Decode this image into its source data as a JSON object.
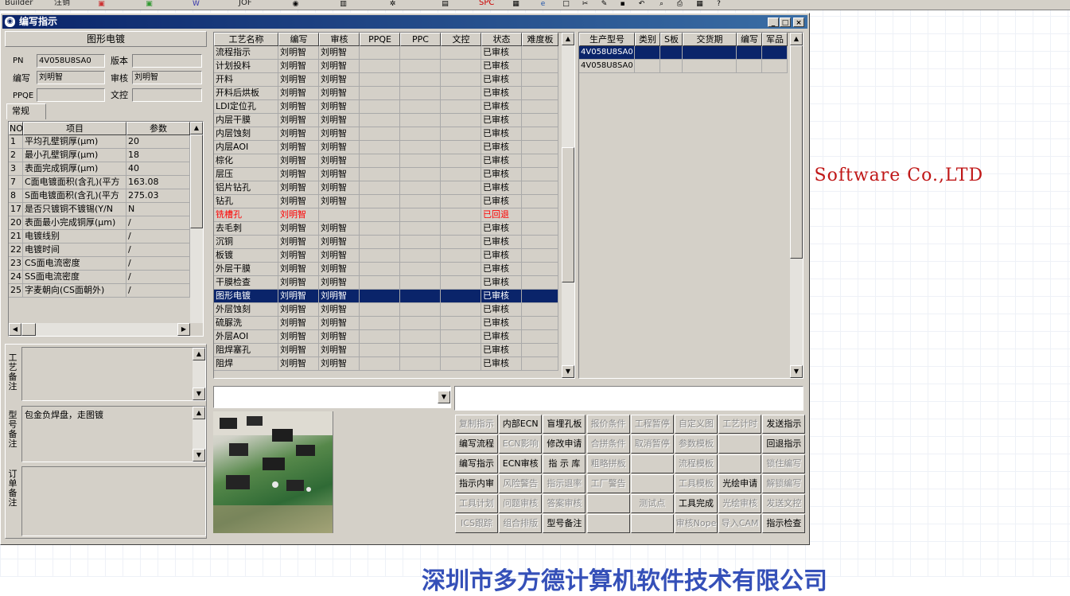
{
  "toolbar": {
    "items": [
      "Builder",
      "注销",
      "",
      "",
      "",
      "JOF",
      "",
      "",
      "",
      "",
      "SPC",
      "",
      "",
      "",
      "",
      "",
      "",
      "",
      ""
    ],
    "icons": [
      "builder",
      "logout-icon",
      "doc-red-icon",
      "excel-icon",
      "word-icon",
      "jof-icon",
      "cd-icon",
      "db-icon",
      "gear-icon",
      "printer-icon",
      "spc-icon",
      "image-icon",
      "ie-icon",
      "new-icon",
      "cut-icon",
      "pen-icon",
      "save-icon",
      "undo-icon",
      "zoom-icon",
      "print-icon",
      "calc-icon",
      "help-icon"
    ]
  },
  "background": {
    "company_text": "er Software Co.,LTD",
    "bottom_text": "深圳市多方德计算机软件技术有限公司"
  },
  "window": {
    "title": "编写指示",
    "controls": [
      "_",
      "□",
      "×"
    ]
  },
  "left": {
    "header": "图形电镀",
    "pn_label": "PN",
    "pn_value": "4V058U8SA0",
    "version_label": "版本",
    "version_value": "",
    "author_label": "编写",
    "author_value": "刘明智",
    "review_label": "审核",
    "review_value": "刘明智",
    "ppqe_label": "PPQE",
    "ppqe_value": "",
    "doc_label": "文控",
    "doc_value": "",
    "tab": "常规",
    "params_columns": [
      "NO",
      "项目",
      "参数"
    ],
    "params": [
      {
        "no": "1",
        "item": "平均孔壁铜厚(μm)",
        "value": "20"
      },
      {
        "no": "2",
        "item": "最小孔壁铜厚(μm)",
        "value": "18"
      },
      {
        "no": "3",
        "item": "表面完成铜厚(μm)",
        "value": "40"
      },
      {
        "no": "7",
        "item": "C面电镀面积(含孔)(平方",
        "value": "163.08"
      },
      {
        "no": "8",
        "item": "S面电镀面积(含孔)(平方",
        "value": "275.03"
      },
      {
        "no": "17",
        "item": "是否只镀铜不镀锡(Y/N",
        "value": "N"
      },
      {
        "no": "20",
        "item": "表面最小完成铜厚(μm)",
        "value": "/"
      },
      {
        "no": "21",
        "item": "电镀线别",
        "value": "/"
      },
      {
        "no": "22",
        "item": "电镀时间",
        "value": "/"
      },
      {
        "no": "23",
        "item": "CS面电流密度",
        "value": "/"
      },
      {
        "no": "24",
        "item": "SS面电流密度",
        "value": "/"
      },
      {
        "no": "25",
        "item": "字麦朝向(CS面朝外)",
        "value": "/"
      }
    ],
    "notes": [
      {
        "label": "工艺备注",
        "text": ""
      },
      {
        "label": "型号备注",
        "text": "包金负焊盘，走图镀"
      },
      {
        "label": "订单备注",
        "text": ""
      }
    ]
  },
  "process_grid": {
    "columns": [
      "工艺名称",
      "编写",
      "审核",
      "PPQE",
      "PPC",
      "文控",
      "状态",
      "难度板"
    ],
    "rows": [
      {
        "name": "流程指示",
        "author": "刘明智",
        "review": "刘明智",
        "status": "已审核"
      },
      {
        "name": "计划投料",
        "author": "刘明智",
        "review": "刘明智",
        "status": "已审核"
      },
      {
        "name": "开料",
        "author": "刘明智",
        "review": "刘明智",
        "status": "已审核"
      },
      {
        "name": "开料后烘板",
        "author": "刘明智",
        "review": "刘明智",
        "status": "已审核"
      },
      {
        "name": "LDI定位孔",
        "author": "刘明智",
        "review": "刘明智",
        "status": "已审核"
      },
      {
        "name": "内层干膜",
        "author": "刘明智",
        "review": "刘明智",
        "status": "已审核"
      },
      {
        "name": "内层蚀刻",
        "author": "刘明智",
        "review": "刘明智",
        "status": "已审核"
      },
      {
        "name": "内层AOI",
        "author": "刘明智",
        "review": "刘明智",
        "status": "已审核"
      },
      {
        "name": "棕化",
        "author": "刘明智",
        "review": "刘明智",
        "status": "已审核"
      },
      {
        "name": "层压",
        "author": "刘明智",
        "review": "刘明智",
        "status": "已审核"
      },
      {
        "name": "铝片钻孔",
        "author": "刘明智",
        "review": "刘明智",
        "status": "已审核"
      },
      {
        "name": "钻孔",
        "author": "刘明智",
        "review": "刘明智",
        "status": "已审核"
      },
      {
        "name": "铣槽孔",
        "author": "刘明智",
        "review": "",
        "status": "已回退"
      },
      {
        "name": "去毛刺",
        "author": "刘明智",
        "review": "刘明智",
        "status": "已审核"
      },
      {
        "name": "沉铜",
        "author": "刘明智",
        "review": "刘明智",
        "status": "已审核"
      },
      {
        "name": "板镀",
        "author": "刘明智",
        "review": "刘明智",
        "status": "已审核"
      },
      {
        "name": "外层干膜",
        "author": "刘明智",
        "review": "刘明智",
        "status": "已审核"
      },
      {
        "name": "干膜检查",
        "author": "刘明智",
        "review": "刘明智",
        "status": "已审核"
      },
      {
        "name": "图形电镀",
        "author": "刘明智",
        "review": "刘明智",
        "status": "已审核"
      },
      {
        "name": "外层蚀刻",
        "author": "刘明智",
        "review": "刘明智",
        "status": "已审核"
      },
      {
        "name": "硫脲洗",
        "author": "刘明智",
        "review": "刘明智",
        "status": "已审核"
      },
      {
        "name": "外层AOI",
        "author": "刘明智",
        "review": "刘明智",
        "status": "已审核"
      },
      {
        "name": "阻焊塞孔",
        "author": "刘明智",
        "review": "刘明智",
        "status": "已审核"
      },
      {
        "name": "阻焊",
        "author": "刘明智",
        "review": "刘明智",
        "status": "已审核"
      }
    ]
  },
  "model_grid": {
    "columns": [
      "生产型号",
      "类别",
      "S板",
      "交货期",
      "编写",
      "军品"
    ],
    "rows": [
      {
        "model": "4V058U8SA0"
      },
      {
        "model": "4V058U8SA0"
      }
    ]
  },
  "action_buttons": [
    [
      {
        "label": "复制指示",
        "enabled": false
      },
      {
        "label": "内部ECN",
        "enabled": true
      },
      {
        "label": "盲埋孔板",
        "enabled": true
      },
      {
        "label": "报价条件",
        "enabled": false
      },
      {
        "label": "工程暂停",
        "enabled": false
      },
      {
        "label": "自定义图",
        "enabled": false
      },
      {
        "label": "工艺计时",
        "enabled": false
      },
      {
        "label": "发送指示",
        "enabled": true
      }
    ],
    [
      {
        "label": "编写流程",
        "enabled": true
      },
      {
        "label": "ECN影响",
        "enabled": false
      },
      {
        "label": "修改申请",
        "enabled": true
      },
      {
        "label": "合拼条件",
        "enabled": false
      },
      {
        "label": "取消暂停",
        "enabled": false
      },
      {
        "label": "参数模板",
        "enabled": false
      },
      {
        "label": "",
        "enabled": false
      },
      {
        "label": "回退指示",
        "enabled": true
      }
    ],
    [
      {
        "label": "编写指示",
        "enabled": true
      },
      {
        "label": "ECN审核",
        "enabled": true
      },
      {
        "label": "指 示 库",
        "enabled": true
      },
      {
        "label": "粗略拼板",
        "enabled": false
      },
      {
        "label": "",
        "enabled": false
      },
      {
        "label": "流程模板",
        "enabled": false
      },
      {
        "label": "",
        "enabled": false
      },
      {
        "label": "锁住编写",
        "enabled": false
      }
    ],
    [
      {
        "label": "指示内审",
        "enabled": true
      },
      {
        "label": "风险警告",
        "enabled": false
      },
      {
        "label": "指示退率",
        "enabled": false
      },
      {
        "label": "工厂警告",
        "enabled": false
      },
      {
        "label": "",
        "enabled": false
      },
      {
        "label": "工具模板",
        "enabled": false
      },
      {
        "label": "光绘申请",
        "enabled": true
      },
      {
        "label": "解锁编写",
        "enabled": false
      }
    ],
    [
      {
        "label": "工具计划",
        "enabled": false
      },
      {
        "label": "问题审核",
        "enabled": false
      },
      {
        "label": "答案审核",
        "enabled": false
      },
      {
        "label": "",
        "enabled": false
      },
      {
        "label": "测试点",
        "enabled": false
      },
      {
        "label": "工具完成",
        "enabled": true
      },
      {
        "label": "光绘审核",
        "enabled": false
      },
      {
        "label": "发送文控",
        "enabled": false
      }
    ],
    [
      {
        "label": "ICS跟踪",
        "enabled": false
      },
      {
        "label": "组合排版",
        "enabled": false
      },
      {
        "label": "型号备注",
        "enabled": true
      },
      {
        "label": "",
        "enabled": false
      },
      {
        "label": "",
        "enabled": false
      },
      {
        "label": "审核Nope",
        "enabled": false
      },
      {
        "label": "导入CAM",
        "enabled": false
      },
      {
        "label": "指示检查",
        "enabled": true
      }
    ]
  ],
  "colors": {
    "selection": "#0a246a",
    "face": "#d4d0c8",
    "red": "#ff0000",
    "title_start": "#0a246a",
    "title_end": "#3a6ea5"
  }
}
